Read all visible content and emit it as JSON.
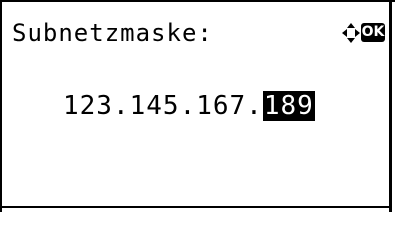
{
  "screen": {
    "title": "Subnetzmaske:",
    "ok_label": "OK",
    "value_prefix": "123.145.167.",
    "value_selected": "189"
  },
  "icons": {
    "nav": "four-way-arrow-icon",
    "ok": "ok-key-icon"
  },
  "colors": {
    "foreground": "#000000",
    "background": "#ffffff"
  }
}
